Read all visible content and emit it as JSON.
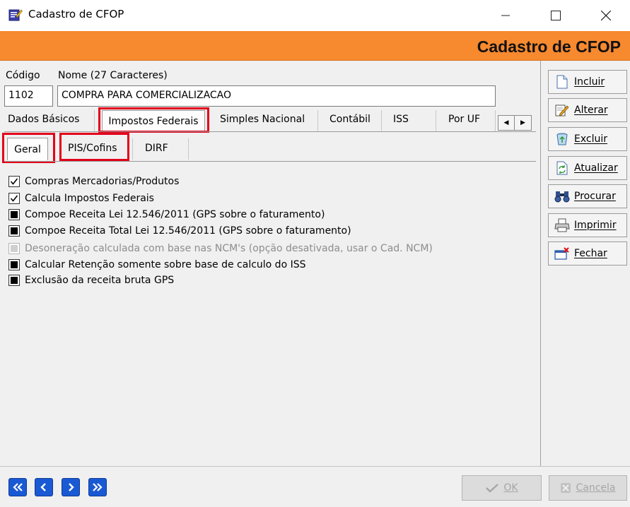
{
  "window": {
    "title": "Cadastro de CFOP"
  },
  "banner": {
    "title": "Cadastro de CFOP"
  },
  "form": {
    "codigo_label": "Código",
    "codigo_value": "1102",
    "nome_label": "Nome (27 Caracteres)",
    "nome_value": "COMPRA PARA COMERCIALIZACAO"
  },
  "tabs": [
    {
      "label": "Dados Básicos"
    },
    {
      "label": "Impostos Federais"
    },
    {
      "label": "Simples Nacional"
    },
    {
      "label": "Contábil"
    },
    {
      "label": "ISS"
    },
    {
      "label": "Por UF"
    }
  ],
  "subtabs": [
    {
      "label": "Geral"
    },
    {
      "label": "PIS/Cofins"
    },
    {
      "label": "DIRF"
    }
  ],
  "options": [
    {
      "label": "Compras Mercadorias/Produtos",
      "state": "checked"
    },
    {
      "label": "Calcula Impostos Federais",
      "state": "checked"
    },
    {
      "label": "Compoe Receita Lei 12.546/2011 (GPS sobre o faturamento)",
      "state": "indeterminate"
    },
    {
      "label": "Compoe Receita Total Lei 12.546/2011 (GPS sobre o faturamento)",
      "state": "indeterminate"
    },
    {
      "label": "Desoneração calculada com base nas NCM's (opção desativada, usar o Cad. NCM)",
      "state": "disabled"
    },
    {
      "label": "Calcular Retenção somente sobre base de calculo do ISS",
      "state": "indeterminate"
    },
    {
      "label": "Exclusão da receita bruta GPS",
      "state": "indeterminate"
    }
  ],
  "sidebar": {
    "buttons": [
      {
        "label": "Incluir",
        "icon": "document-icon"
      },
      {
        "label": "Alterar",
        "icon": "edit-icon"
      },
      {
        "label": "Excluir",
        "icon": "recycle-bin-icon"
      },
      {
        "label": "Atualizar",
        "icon": "refresh-icon"
      },
      {
        "label": "Procurar",
        "icon": "binoculars-icon"
      },
      {
        "label": "Imprimir",
        "icon": "printer-icon"
      },
      {
        "label": "Fechar",
        "icon": "exit-icon"
      }
    ]
  },
  "footer": {
    "ok_label": "OK",
    "cancel_label": "Cancela"
  },
  "colors": {
    "banner": "#f7892f",
    "highlight": "#e3001b",
    "nav_blue": "#1a59d4"
  }
}
